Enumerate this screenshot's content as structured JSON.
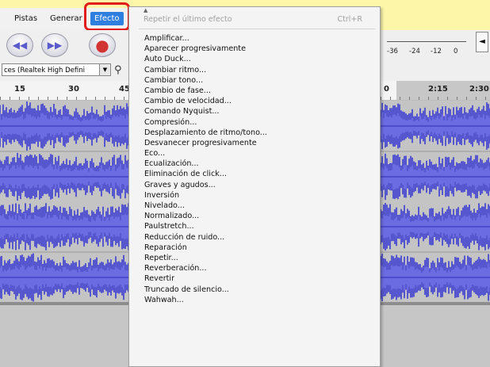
{
  "menubar": {
    "items": [
      "Pistas",
      "Generar",
      "Efecto"
    ]
  },
  "device": {
    "selected": "ces (Realtek High Defini"
  },
  "meter": {
    "labels": [
      "-36",
      "-24",
      "-12",
      "0"
    ]
  },
  "ruler": {
    "ticks": [
      "15",
      "30",
      "45",
      "0",
      "2:15",
      "2:30"
    ]
  },
  "menu": {
    "repeat_label": "Repetir el último efecto",
    "repeat_shortcut": "Ctrl+R",
    "items": [
      "Amplificar...",
      "Aparecer progresivamente",
      "Auto Duck...",
      "Cambiar ritmo...",
      "Cambiar tono...",
      "Cambio de fase...",
      "Cambio de velocidad...",
      "Comando Nyquist...",
      "Compresión...",
      "Desplazamiento de ritmo/tono...",
      "Desvanecer progresivamente",
      "Eco...",
      "Ecualización...",
      "Eliminación de click...",
      "Graves y agudos...",
      "Inversión",
      "Nivelado...",
      "Normalizado...",
      "Paulstretch...",
      "Reducción de ruido...",
      "Reparación",
      "Repetir...",
      "Reverberación...",
      "Revertir",
      "Truncado de silencio...",
      "Wahwah..."
    ]
  },
  "colors": {
    "waveform": "#3b3bd1",
    "waveform_rms": "#6b6be8",
    "selection": "#2f7fe0",
    "highlight": "#e21b1b",
    "background": "#fdf6a8"
  },
  "icons": [
    "skip-back-icon",
    "skip-forward-icon",
    "record-icon",
    "microphone-icon",
    "dropdown-arrow-icon",
    "scroll-up-icon"
  ]
}
